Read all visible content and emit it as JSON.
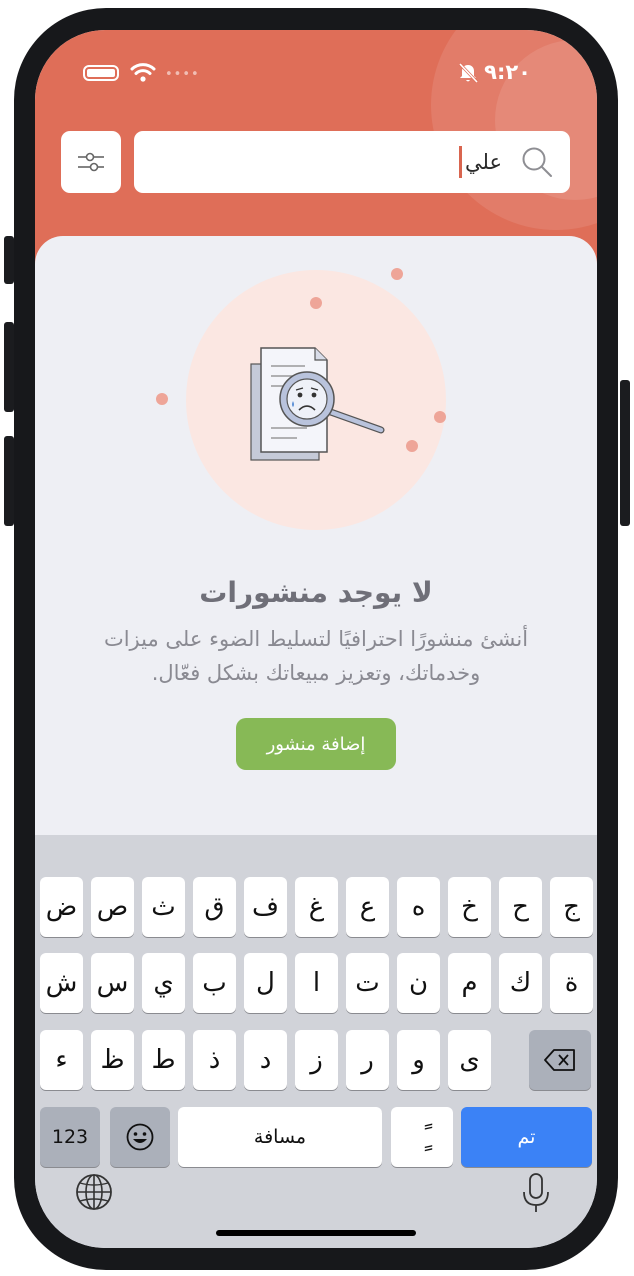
{
  "status_bar": {
    "time": "٩:٢٠"
  },
  "search": {
    "value": "علي"
  },
  "empty_state": {
    "title": "لا يوجد منشورات",
    "description_line1": "أنشئ منشورًا احترافيًا لتسليط الضوء على ميزات",
    "description_line2": "وخدماتك، وتعزيز مبيعاتك بشكل فعّال.",
    "button_label": "إضافة منشور"
  },
  "keyboard": {
    "row1": [
      "ض",
      "ص",
      "ث",
      "ق",
      "ف",
      "غ",
      "ع",
      "ه",
      "خ",
      "ح",
      "ج"
    ],
    "row2": [
      "ش",
      "س",
      "ي",
      "ب",
      "ل",
      "ا",
      "ت",
      "ن",
      "م",
      "ك",
      "ة"
    ],
    "row3": [
      "ء",
      "ظ",
      "ط",
      "ذ",
      "د",
      "ز",
      "ر",
      "و",
      "ى"
    ],
    "numbers_label": "123",
    "space_label": "مسافة",
    "diacritic_label": "ًٍ",
    "done_label": "تم"
  },
  "colors": {
    "header": "#df6e58",
    "button": "#87b956",
    "done_key": "#3b82f6"
  },
  "icons": [
    "filter-sliders-icon",
    "search-icon",
    "bell-slash-icon",
    "wifi-icon",
    "battery-icon",
    "empty-search-illustration",
    "emoji-icon",
    "backspace-icon",
    "globe-icon",
    "mic-icon"
  ]
}
